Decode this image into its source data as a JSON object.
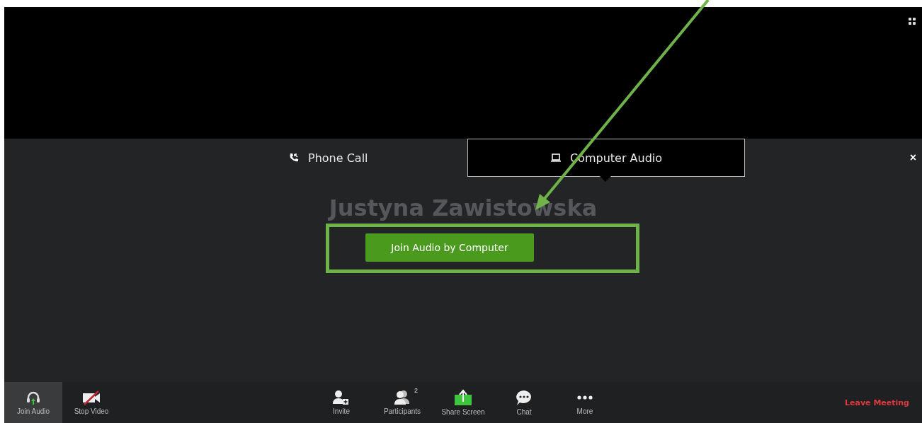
{
  "audio_panel": {
    "tabs": [
      {
        "label": "Phone Call",
        "kind": "phone",
        "selected": false
      },
      {
        "label": "Computer Audio",
        "kind": "computer",
        "selected": true
      }
    ],
    "close": "×",
    "participant_name": "Justyna Zawistowska",
    "join_button": "Join Audio by Computer"
  },
  "toolbar": {
    "items": [
      {
        "label": "Join Audio",
        "kind": "headphones",
        "selected": true
      },
      {
        "label": "Stop Video",
        "kind": "video-off",
        "selected": false
      }
    ],
    "center_items": [
      {
        "label": "Invite",
        "kind": "invite"
      },
      {
        "label": "Participants",
        "kind": "participants",
        "badge": "2"
      },
      {
        "label": "Share Screen",
        "kind": "share"
      },
      {
        "label": "Chat",
        "kind": "chat"
      },
      {
        "label": "More",
        "kind": "more"
      }
    ],
    "leave": "Leave Meeting"
  }
}
